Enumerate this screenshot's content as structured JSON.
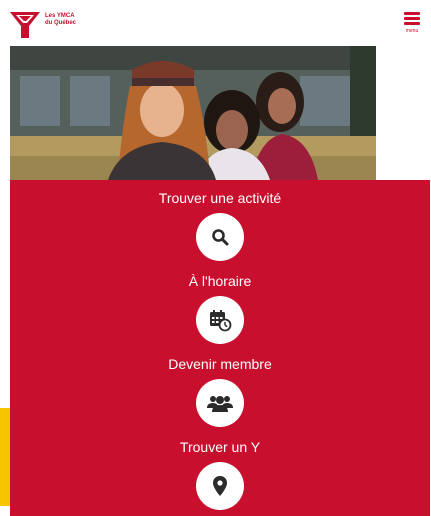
{
  "header": {
    "logo_line1": "Les YMCA",
    "logo_line2": "du Québec",
    "menu_label": "menu"
  },
  "nav": [
    {
      "label": "Trouver une activité",
      "icon": "search-icon"
    },
    {
      "label": "À l'horaire",
      "icon": "calendar-clock-icon"
    },
    {
      "label": "Devenir membre",
      "icon": "people-icon"
    },
    {
      "label": "Trouver un Y",
      "icon": "map-pin-icon"
    }
  ],
  "colors": {
    "brand_red": "#c8102e",
    "accent_yellow": "#f7c500",
    "icon_dark": "#2b2b2b"
  }
}
